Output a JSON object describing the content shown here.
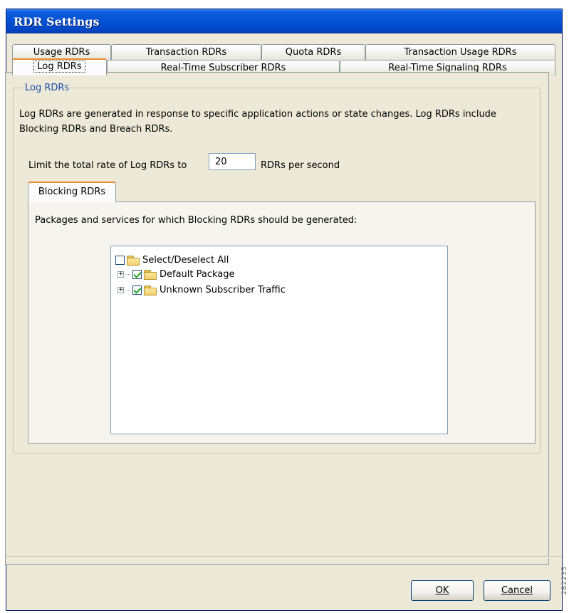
{
  "window": {
    "title": "RDR Settings"
  },
  "tabs_row1": [
    {
      "label": "Usage RDRs"
    },
    {
      "label": "Transaction RDRs"
    },
    {
      "label": "Quota RDRs"
    },
    {
      "label": "Transaction Usage RDRs"
    }
  ],
  "tabs_row2": [
    {
      "label": "Log RDRs",
      "active": true
    },
    {
      "label": "Real-Time Subscriber RDRs"
    },
    {
      "label": "Real-Time Signaling RDRs"
    }
  ],
  "group": {
    "legend": "Log RDRs",
    "description": "Log RDRs are generated in response to specific application actions or state changes. Log RDRs include Blocking RDRs and Breach RDRs.",
    "rate_label": "Limit the total rate of Log RDRs to",
    "rate_value": "20",
    "rate_suffix": "RDRs per second"
  },
  "blocking": {
    "tab_label": "Blocking RDRs",
    "description": "Packages and services for which Blocking RDRs should be generated:",
    "tree": [
      {
        "label": "Select/Deselect All",
        "checked": false,
        "expandable": false
      },
      {
        "label": "Default Package",
        "checked": true,
        "expandable": true
      },
      {
        "label": "Unknown Subscriber Traffic",
        "checked": true,
        "expandable": true
      }
    ]
  },
  "buttons": {
    "ok": "OK",
    "cancel": "Cancel"
  },
  "watermark": "282235"
}
